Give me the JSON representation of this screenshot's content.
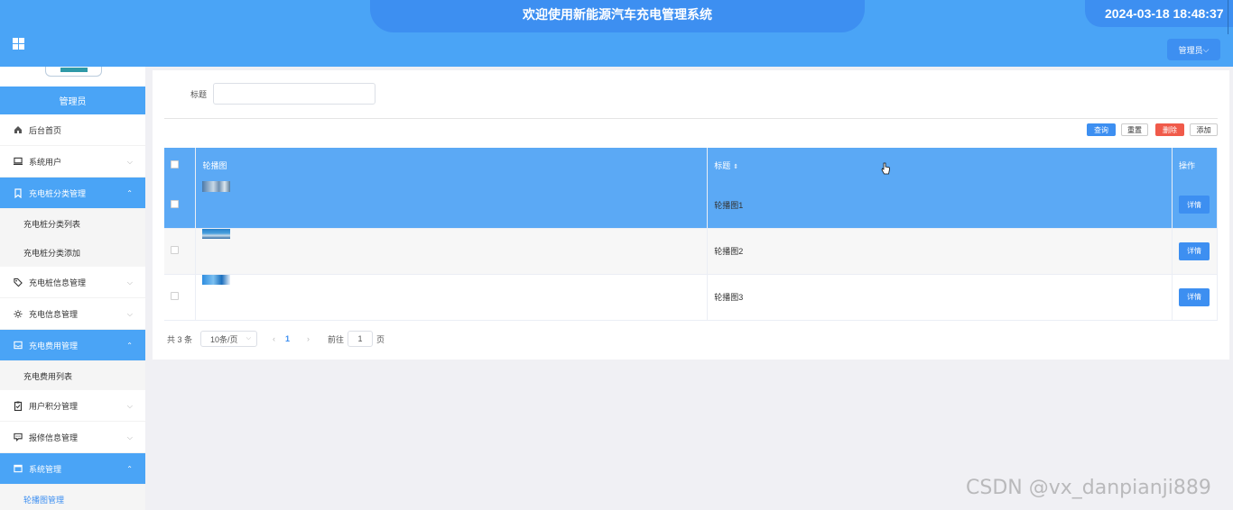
{
  "header": {
    "title": "欢迎使用新能源汽车充电管理系统",
    "datetime": "2024-03-18 18:48:37",
    "user_menu": "管理员"
  },
  "sidebar": {
    "role": "管理员",
    "items": [
      {
        "label": "后台首页",
        "icon": "home-icon"
      },
      {
        "label": "系统用户",
        "icon": "monitor-icon"
      },
      {
        "label": "充电桩分类管理",
        "icon": "bookmark-icon",
        "sub": [
          "充电桩分类列表",
          "充电桩分类添加"
        ]
      },
      {
        "label": "充电桩信息管理",
        "icon": "tag-icon"
      },
      {
        "label": "充电信息管理",
        "icon": "sun-icon"
      },
      {
        "label": "充电费用管理",
        "icon": "inbox-icon",
        "sub": [
          "充电费用列表"
        ]
      },
      {
        "label": "用户积分管理",
        "icon": "clipboard-icon"
      },
      {
        "label": "报修信息管理",
        "icon": "message-icon"
      },
      {
        "label": "系统管理",
        "icon": "window-icon",
        "sub": [
          "轮播图管理"
        ]
      }
    ]
  },
  "search": {
    "label": "标题",
    "value": ""
  },
  "toolbar": {
    "query": "查询",
    "reset": "重置",
    "delete": "删除",
    "add": "添加"
  },
  "table": {
    "columns": [
      "轮播图",
      "标题",
      "操作"
    ],
    "rows": [
      {
        "title": "轮播图1",
        "action": "详情"
      },
      {
        "title": "轮播图2",
        "action": "详情"
      },
      {
        "title": "轮播图3",
        "action": "详情"
      }
    ]
  },
  "pager": {
    "total": "共 3 条",
    "page_size": "10条/页",
    "current_page": "1",
    "goto_label": "前往",
    "goto_value": "1",
    "page_suffix": "页"
  },
  "watermark": "CSDN @vx_danpianji889",
  "colors": {
    "primary": "#3d8ff1",
    "header": "#4aa4f6",
    "danger": "#f05a4a"
  }
}
